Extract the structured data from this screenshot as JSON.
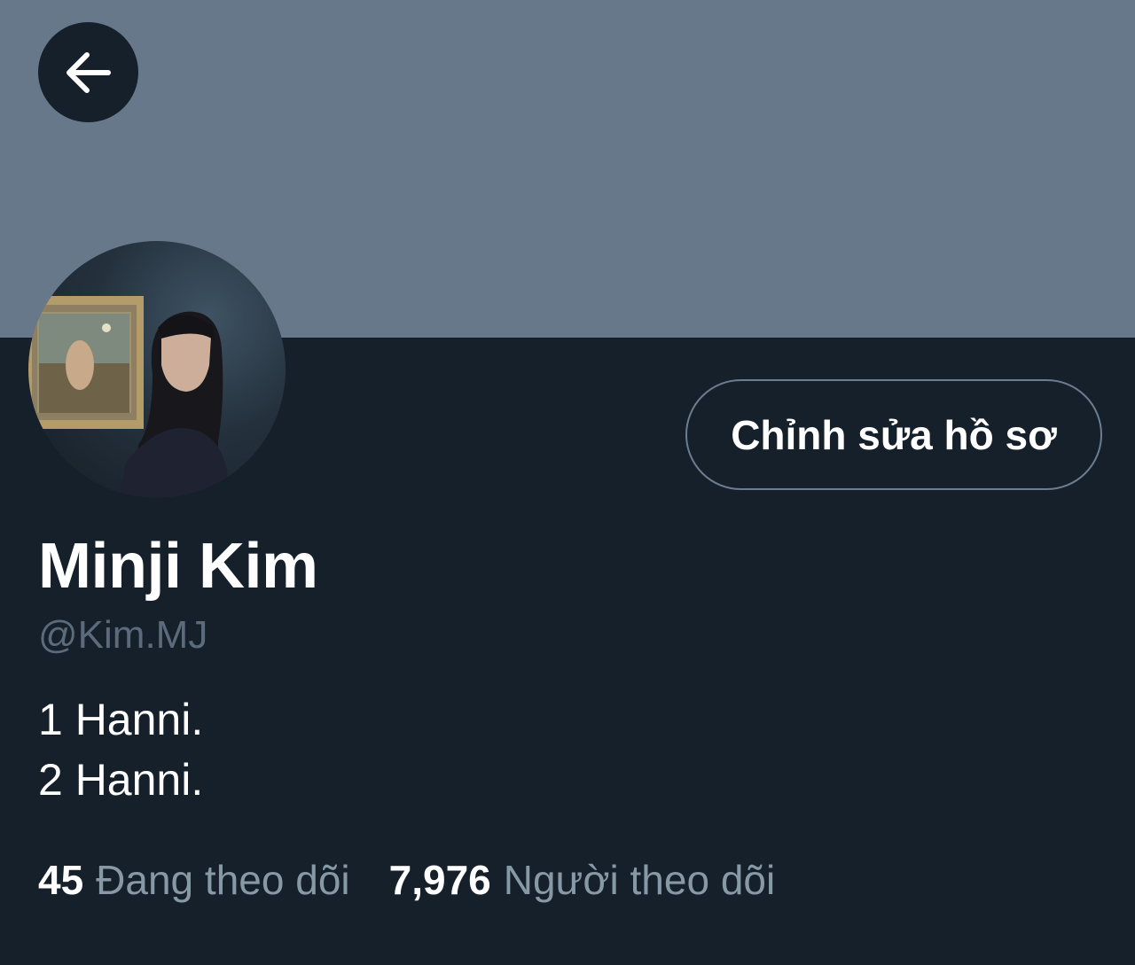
{
  "header": {
    "banner_color": "#66788a",
    "back_icon": "arrow-left-icon"
  },
  "profile": {
    "display_name": "Minji Kim",
    "handle": "@Kim.MJ",
    "bio_lines": [
      "1 Hanni.",
      "2 Hanni."
    ],
    "edit_button_label": "Chỉnh sửa hồ sơ",
    "avatar_description": "profile-photo"
  },
  "stats": {
    "following_count": "45",
    "following_label": "Đang theo dõi",
    "followers_count": "7,976",
    "followers_label": "Người theo dõi"
  },
  "colors": {
    "background": "#15202b",
    "text_primary": "#ffffff",
    "text_secondary": "#8899a6",
    "button_border": "#6b7d8f"
  }
}
